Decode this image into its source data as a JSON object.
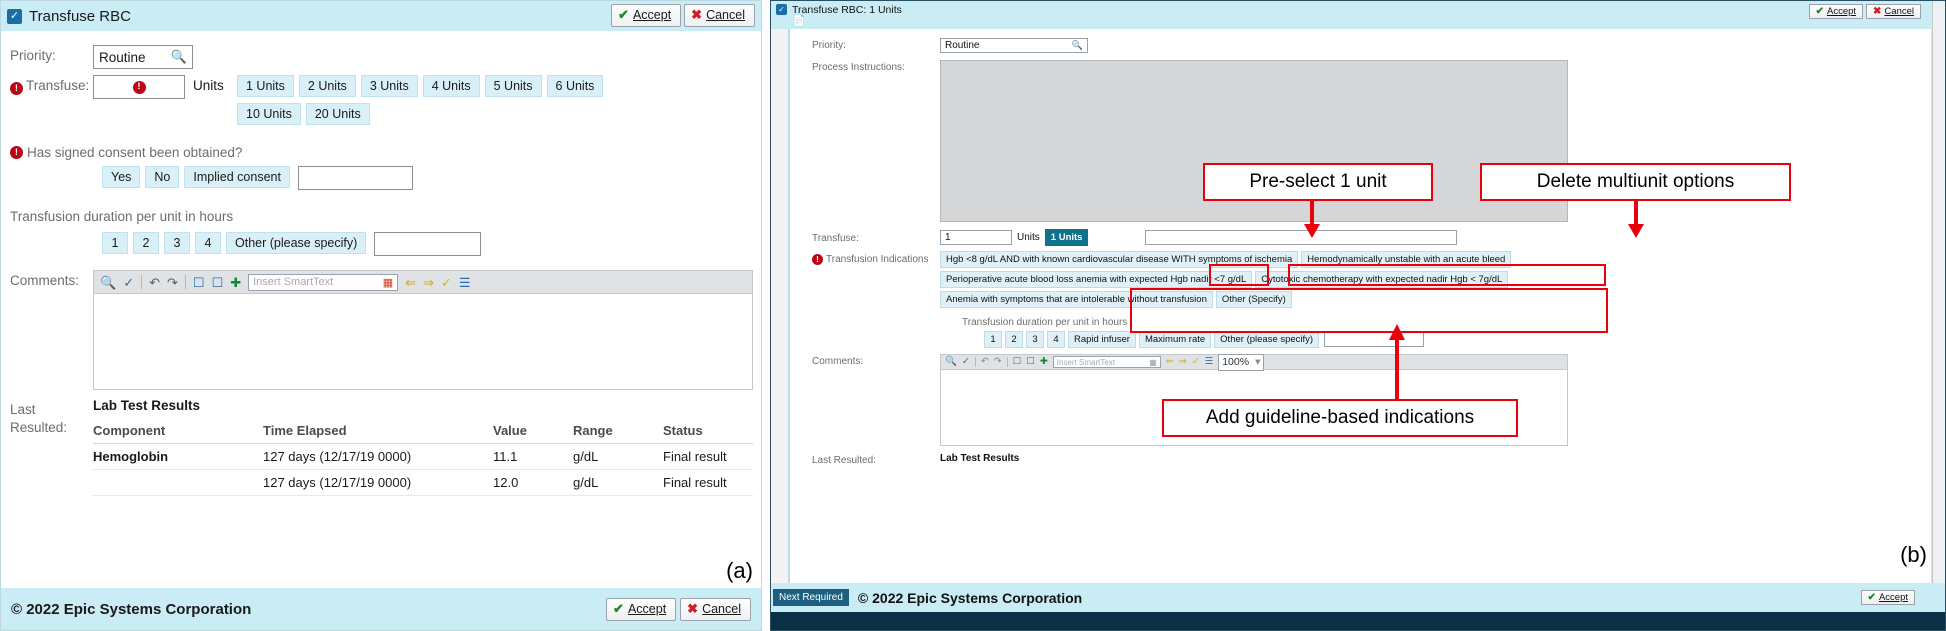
{
  "panel_a": {
    "figure_label": "(a)",
    "titlebar": {
      "title": "Transfuse RBC",
      "checkbox_icon": "checkmark-icon",
      "accept": "Accept",
      "cancel": "Cancel",
      "accept_icon": "check-icon",
      "cancel_icon": "x-icon"
    },
    "priority": {
      "label": "Priority:",
      "value": "Routine",
      "search_icon": "magnifier-icon"
    },
    "transfuse": {
      "label": "Transfuse:",
      "value": "",
      "alert_icon": "alert-icon",
      "units_label": "Units",
      "options": [
        "1 Units",
        "2 Units",
        "3 Units",
        "4 Units",
        "5 Units",
        "6 Units",
        "10 Units",
        "20 Units"
      ]
    },
    "consent": {
      "question": "Has signed consent been obtained?",
      "alert_icon": "alert-icon",
      "options": [
        "Yes",
        "No",
        "Implied consent"
      ],
      "free_text": ""
    },
    "duration": {
      "label": "Transfusion duration per unit in hours",
      "options": [
        "1",
        "2",
        "3",
        "4",
        "Other (please specify)"
      ],
      "free_text": ""
    },
    "comments": {
      "label": "Comments:",
      "smarttext_placeholder": "Insert SmartText",
      "value": "",
      "toolbar_icons": [
        "zoom-icon",
        "spellcheck-icon",
        "undo-icon",
        "redo-icon",
        "help-icon",
        "help-add-icon",
        "plus-icon",
        "smarttext-icon",
        "prev-icon",
        "next-icon",
        "wand-icon",
        "list-icon"
      ]
    },
    "last_resulted": {
      "label_line1": "Last",
      "label_line2": "Resulted:",
      "section_title": "Lab Test Results",
      "columns": [
        "Component",
        "Time Elapsed",
        "Value",
        "Range",
        "Status"
      ],
      "rows": [
        [
          "Hemoglobin",
          "127 days (12/17/19 0000)",
          "11.1",
          "g/dL",
          "Final result"
        ],
        [
          "",
          "127 days (12/17/19 0000)",
          "12.0",
          "g/dL",
          "Final result"
        ]
      ]
    },
    "footer": {
      "copyright": "© 2022 Epic Systems Corporation",
      "accept": "Accept",
      "cancel": "Cancel"
    }
  },
  "panel_b": {
    "figure_label": "(b)",
    "titlebar": {
      "title": "Transfuse RBC: 1 Units",
      "checkbox_icon": "checkmark-icon",
      "doc_icon": "document-info-icon",
      "accept": "Accept",
      "cancel": "Cancel"
    },
    "priority": {
      "label": "Priority:",
      "value": "Routine",
      "search_icon": "magnifier-icon"
    },
    "process_instructions": {
      "label": "Process Instructions:",
      "value": "",
      "scroll_up_icon": "chevron-up-icon",
      "scroll_down_icon": "chevron-down-icon"
    },
    "transfuse": {
      "label": "Transfuse:",
      "value": "1",
      "units_label": "Units",
      "options": [
        "1 Units"
      ],
      "selected": "1 Units"
    },
    "indications": {
      "label": "Transfusion Indications",
      "alert_icon": "alert-icon",
      "options": [
        "Hgb <8 g/dL AND with known cardiovascular disease WITH symptoms of ischemia",
        "Hemodynamically unstable with an acute bleed",
        "Perioperative acute blood loss anemia with expected Hgb nadir <7 g/dL",
        "Cytotoxic chemotherapy with expected nadir Hgb < 7g/dL",
        "Anemia with symptoms that are intolerable without transfusion",
        "Other (Specify)"
      ]
    },
    "duration": {
      "label": "Transfusion duration per unit in hours",
      "options": [
        "1",
        "2",
        "3",
        "4",
        "Rapid infuser",
        "Maximum rate",
        "Other (please specify)"
      ],
      "free_text": ""
    },
    "comments": {
      "label": "Comments:",
      "smarttext_placeholder": "Insert SmartText",
      "zoom_level": "100%",
      "value": ""
    },
    "last_resulted": {
      "label": "Last Resulted:",
      "section_title": "Lab Test Results"
    },
    "footer": {
      "next_required": "Next Required",
      "copyright": "© 2022 Epic Systems Corporation",
      "accept": "Accept"
    },
    "annotations": [
      {
        "text": "Pre-select 1 unit"
      },
      {
        "text": "Delete multiunit options"
      },
      {
        "text": "Add guideline-based indications"
      }
    ]
  },
  "colors": {
    "header_bg": "#c9ecf5",
    "accent_teal": "#10718d",
    "annotation_red": "#e8000b",
    "alert_red": "#c00418",
    "option_bg": "#d9f0f8"
  }
}
